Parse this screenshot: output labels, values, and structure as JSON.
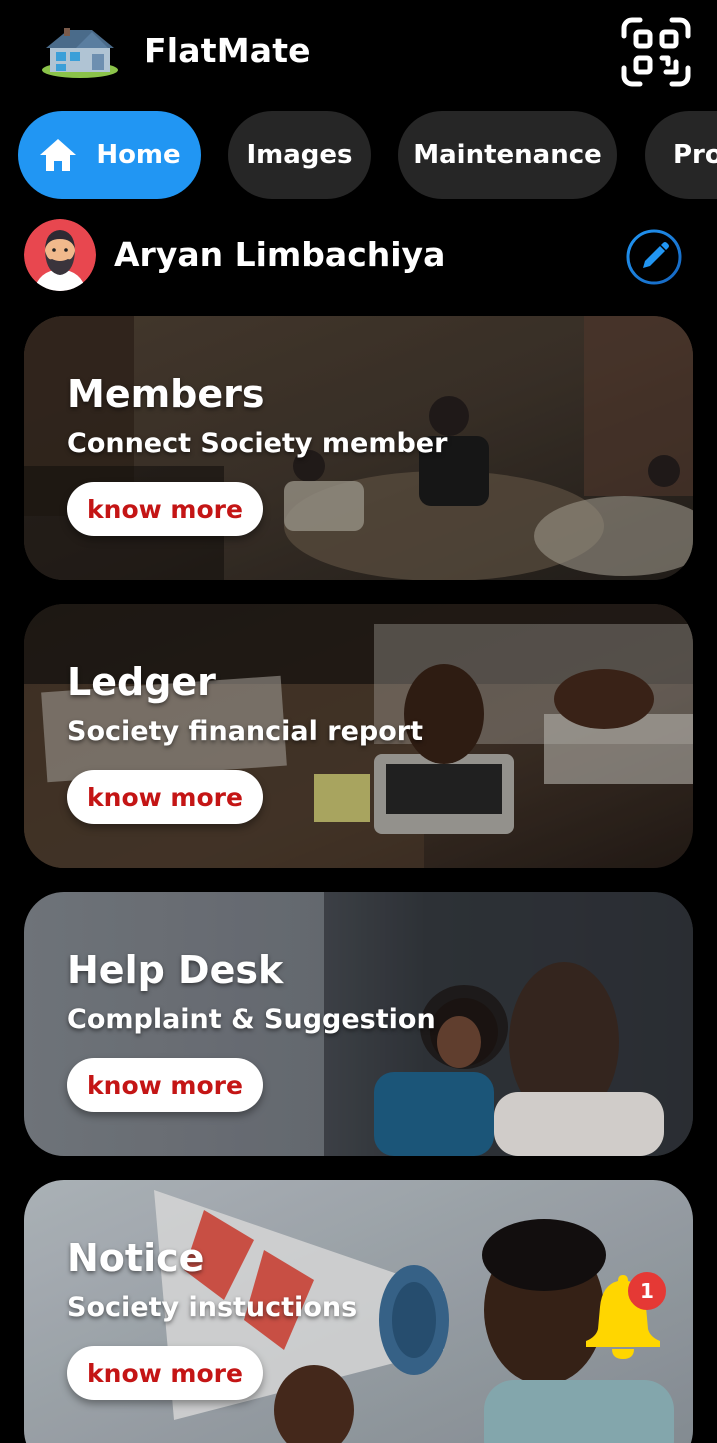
{
  "header": {
    "app_title": "FlatMate",
    "logo_icon": "house-logo-icon",
    "qr_icon": "qr-code-icon"
  },
  "tabs": [
    {
      "label": "Home",
      "icon": "home-icon",
      "active": true
    },
    {
      "label": "Images",
      "active": false
    },
    {
      "label": "Maintenance",
      "active": false
    },
    {
      "label": "Pro",
      "active": false
    }
  ],
  "profile": {
    "name": "Aryan Limbachiya",
    "edit_icon": "pencil-icon"
  },
  "cards": [
    {
      "title": "Members",
      "subtitle": "Connect Society member",
      "button": "know more"
    },
    {
      "title": "Ledger",
      "subtitle": "Society financial report",
      "button": "know more"
    },
    {
      "title": "Help Desk",
      "subtitle": "Complaint & Suggestion",
      "button": "know more"
    },
    {
      "title": "Notice",
      "subtitle": "Society instuctions",
      "button": "know more"
    }
  ],
  "notification": {
    "count": "1",
    "icon": "bell-icon"
  },
  "colors": {
    "accent": "#2196F3",
    "button_text": "#c41515",
    "bell": "#FFD600",
    "badge": "#e53935"
  }
}
